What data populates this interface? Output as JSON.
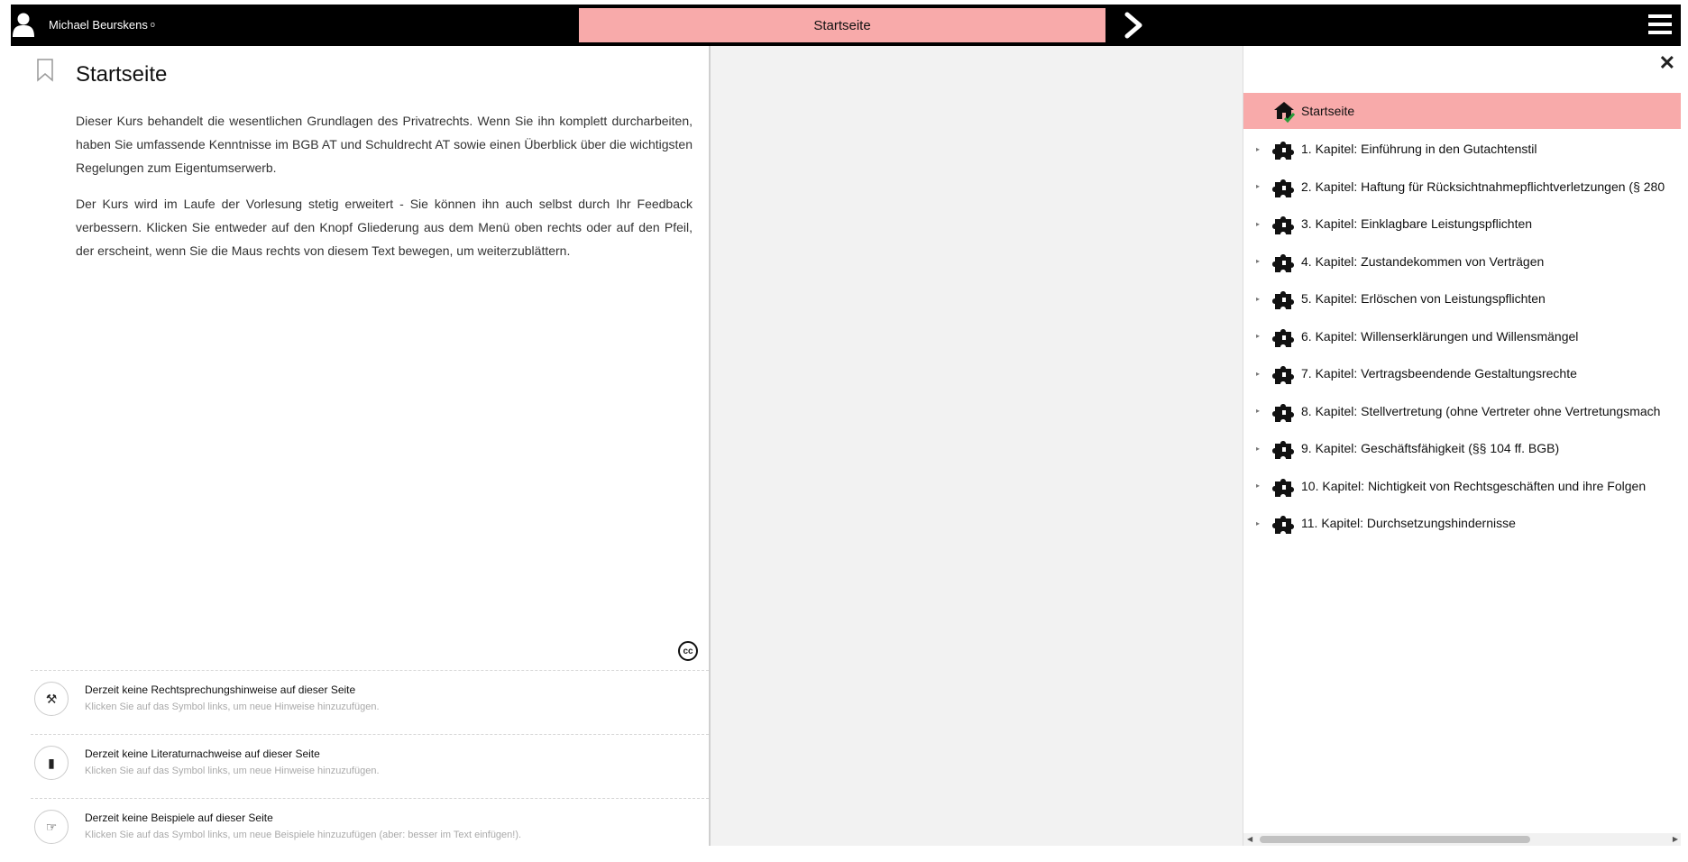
{
  "header": {
    "user_name": "Michael Beurskens",
    "user_suffix": "o",
    "page_title": "Startseite"
  },
  "content": {
    "title": "Startseite",
    "paragraphs": [
      "Dieser Kurs behandelt die wesentlichen Grundlagen des Privatrechts. Wenn Sie ihn komplett durcharbeiten, haben Sie umfassende Kenntnisse im BGB AT und Schuldrecht AT sowie einen Überblick über die wichtigsten Regelungen zum Eigentumserwerb.",
      "Der Kurs wird im Laufe der Vorlesung stetig erweitert - Sie können ihn auch selbst durch Ihr Feedback verbessern. Klicken Sie entweder auf den Knopf Gliederung aus dem Menü oben rechts oder auf den Pfeil, der erscheint, wenn Sie die Maus rechts von diesem Text bewegen, um weiterzublättern."
    ],
    "cc_label": "cc"
  },
  "notes": [
    {
      "title": "Derzeit keine Rechtsprechungshinweise auf dieser Seite",
      "hint": "Klicken Sie auf das Symbol links, um neue Hinweise hinzuzufügen.",
      "icon": "gavel-icon"
    },
    {
      "title": "Derzeit keine Literaturnachweise auf dieser Seite",
      "hint": "Klicken Sie auf das Symbol links, um neue Hinweise hinzuzufügen.",
      "icon": "book-icon"
    },
    {
      "title": "Derzeit keine Beispiele auf dieser Seite",
      "hint": "Klicken Sie auf das Symbol links, um neue Beispiele hinzuzufügen (aber: besser im Text einfügen!).",
      "icon": "pointing-hand-icon"
    }
  ],
  "nav": {
    "home": "Startseite",
    "chapters": [
      "1. Kapitel: Einführung in den Gutachtenstil",
      "2. Kapitel: Haftung für Rücksichtnahmepflichtverletzungen (§ 280",
      "3. Kapitel: Einklagbare Leistungspflichten",
      "4. Kapitel: Zustandekommen von Verträgen",
      "5. Kapitel: Erlöschen von Leistungspflichten",
      "6. Kapitel: Willenserklärungen und Willensmängel",
      "7. Kapitel: Vertragsbeendende Gestaltungsrechte",
      "8. Kapitel: Stellvertretung (ohne Vertreter ohne Vertretungsmach",
      "9. Kapitel: Geschäftsfähigkeit (§§ 104 ff. BGB)",
      "10. Kapitel: Nichtigkeit von Rechtsgeschäften und ihre Folgen",
      "11. Kapitel: Durchsetzungshindernisse"
    ]
  },
  "colors": {
    "accent": "#f8aaaa",
    "bar": "#000000"
  }
}
